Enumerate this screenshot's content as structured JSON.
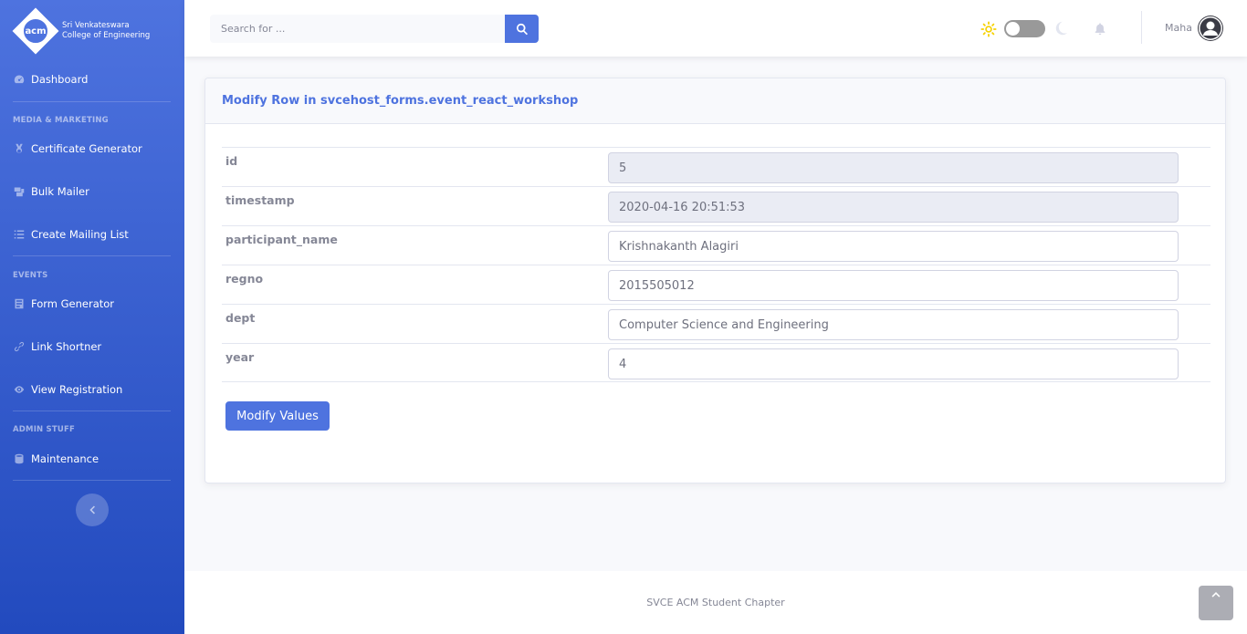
{
  "brand": {
    "logo_text": "acm",
    "line1": "Sri Venkateswara",
    "line2": "College of Engineering"
  },
  "sidebar": {
    "items": [
      {
        "label": "Dashboard",
        "icon": "dashboard-icon"
      },
      {
        "label": "Certificate Generator",
        "icon": "medal-icon"
      },
      {
        "label": "Bulk Mailer",
        "icon": "mail-bulk-icon"
      },
      {
        "label": "Create Mailing List",
        "icon": "list-icon"
      },
      {
        "label": "Form Generator",
        "icon": "form-icon"
      },
      {
        "label": "Link Shortner",
        "icon": "link-icon"
      },
      {
        "label": "View Registration",
        "icon": "eye-icon"
      },
      {
        "label": "Maintenance",
        "icon": "database-icon"
      }
    ],
    "headings": [
      "MEDIA & MARKETING",
      "EVENTS",
      "ADMIN STUFF"
    ]
  },
  "topbar": {
    "search_placeholder": "Search for ...",
    "user_name": "Maha"
  },
  "card": {
    "title": "Modify Row in svcehost_forms.event_react_workshop",
    "fields": [
      {
        "label": "id",
        "value": "5"
      },
      {
        "label": "timestamp",
        "value": "2020-04-16 20:51:53"
      },
      {
        "label": "participant_name",
        "value": "Krishnakanth Alagiri"
      },
      {
        "label": "regno",
        "value": "2015505012"
      },
      {
        "label": "dept",
        "value": "Computer Science and Engineering"
      },
      {
        "label": "year",
        "value": "4"
      }
    ],
    "submit_label": "Modify Values"
  },
  "footer": {
    "text": "SVCE ACM Student Chapter"
  },
  "colors": {
    "primary": "#4e73df",
    "primary_dark": "#224abe",
    "sun": "#f6d100"
  }
}
